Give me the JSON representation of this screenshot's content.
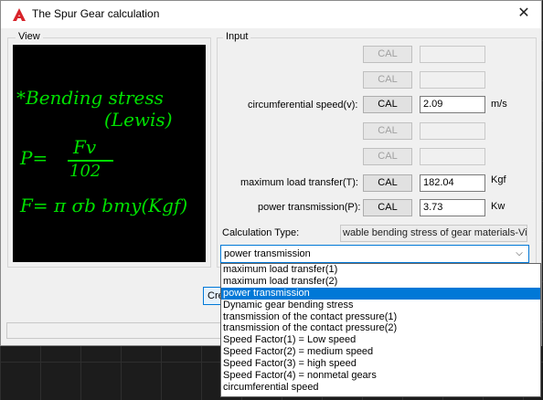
{
  "window": {
    "title": "The Spur Gear calculation",
    "close_glyph": "✕"
  },
  "view": {
    "label": "View",
    "formula_lines": [
      "*Bending stress",
      "(Lewis)",
      "P=",
      "Fv",
      "102",
      "F= π σb bmy(Kgf)"
    ]
  },
  "input": {
    "label": "Input",
    "rows": [
      {
        "label": "",
        "button": "CAL",
        "value": "",
        "unit": "",
        "enabled": false
      },
      {
        "label": "",
        "button": "CAL",
        "value": "",
        "unit": "",
        "enabled": false
      },
      {
        "label": "circumferential speed(v):",
        "button": "CAL",
        "value": "2.09",
        "unit": "m/s",
        "enabled": true
      },
      {
        "label": "",
        "button": "CAL",
        "value": "",
        "unit": "",
        "enabled": false
      },
      {
        "label": "",
        "button": "CAL",
        "value": "",
        "unit": "",
        "enabled": false
      },
      {
        "label": "maximum load transfer(T):",
        "button": "CAL",
        "value": "182.04",
        "unit": "Kgf",
        "enabled": true
      },
      {
        "label": "power transmission(P):",
        "button": "CAL",
        "value": "3.73",
        "unit": "Kw",
        "enabled": true
      }
    ],
    "calc_type_label": "Calculation Type:",
    "calc_type_value": "wable bending stress of gear materials-Vie"
  },
  "combo": {
    "selected": "power transmission",
    "options": [
      "maximum load transfer(1)",
      "maximum load transfer(2)",
      "power transmission",
      "Dynamic gear bending stress",
      "transmission of the contact pressure(1)",
      "transmission of the contact pressure(2)",
      "Speed Factor(1) = Low speed",
      "Speed Factor(2) = medium speed",
      "Speed Factor(3) = high speed",
      "Speed Factor(4) = nonmetal gears",
      "circumferential speed"
    ],
    "highlighted_index": 2
  },
  "create_button": "Cre",
  "colors": {
    "accent": "#0078d7",
    "formula": "#00e000"
  }
}
